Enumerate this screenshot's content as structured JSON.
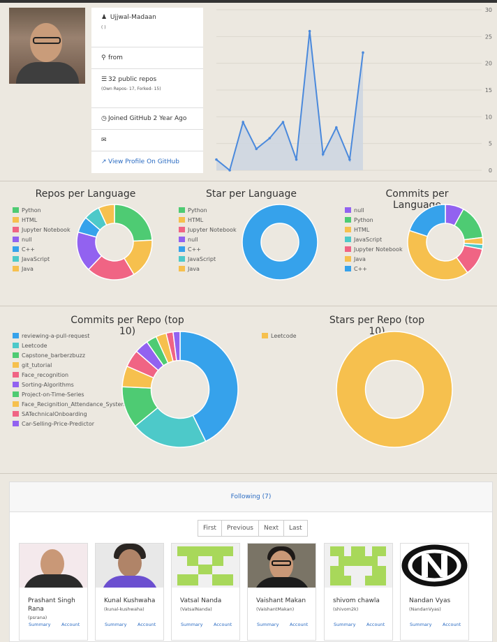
{
  "profile": {
    "username": "Ujjwal-Madaan",
    "name_paren": "( )",
    "location": "from",
    "repos": "32 public repos",
    "repos_detail": "(Own Repos- 17, Forked- 15)",
    "joined": "Joined GitHub 2 Year Ago",
    "email": "",
    "view_profile": "View Profile On GitHub"
  },
  "line_chart": {
    "chart_data": {
      "type": "area",
      "values": [
        2,
        0,
        9,
        4,
        6,
        9,
        2,
        26,
        3,
        8,
        2,
        22
      ],
      "ylim": [
        0,
        30
      ],
      "yticks": [
        "0",
        "5",
        "10",
        "15",
        "20",
        "25",
        "30"
      ],
      "colors": {
        "line": "#4a89dc",
        "fill": "#ccd5e0"
      }
    }
  },
  "repos_per_language": {
    "title": "Repos per Language",
    "chart_data": {
      "type": "pie",
      "labels": [
        "Python",
        "HTML",
        "Jupyter Notebook",
        "null",
        "C++",
        "JavaScript",
        "Java"
      ],
      "values": [
        7,
        5,
        6,
        5,
        2,
        2,
        2
      ],
      "colors": [
        "#4ecb73",
        "#f6c04e",
        "#f06484",
        "#9262f0",
        "#36a2eb",
        "#4dc9c9",
        "#f6c04e"
      ]
    }
  },
  "star_per_language": {
    "title": "Star per Language",
    "chart_data": {
      "type": "pie",
      "labels": [
        "Python",
        "HTML",
        "Jupyter Notebook",
        "null",
        "C++",
        "JavaScript",
        "Java"
      ],
      "values": [
        0,
        0,
        0,
        0,
        1,
        0,
        0
      ],
      "colors": [
        "#4ecb73",
        "#f6c04e",
        "#f06484",
        "#9262f0",
        "#36a2eb",
        "#4dc9c9",
        "#f6c04e"
      ]
    }
  },
  "commits_per_language": {
    "title": "Commits per Language",
    "chart_data": {
      "type": "pie",
      "labels": [
        "null",
        "Python",
        "HTML",
        "JavaScript",
        "Jupyter Notebook",
        "Java",
        "C++"
      ],
      "values": [
        8,
        15,
        3,
        2,
        12,
        40,
        20
      ],
      "colors": [
        "#9262f0",
        "#4ecb73",
        "#f6c04e",
        "#4dc9c9",
        "#f06484",
        "#f6c04e",
        "#36a2eb"
      ]
    }
  },
  "commits_per_repo": {
    "title": "Commits per Repo (top 10)",
    "chart_data": {
      "type": "pie",
      "labels": [
        "reviewing-a-pull-request",
        "Leetcode",
        "Capstone_barberzbuzz",
        "git_tutorial",
        "Face_recognition",
        "Sorting-Algorithms",
        "Project-on-Time-Series",
        "Face_Recignition_Attendance_System",
        "SATechnicalOnboarding",
        "Car-Selling-Price-Predictor"
      ],
      "values": [
        44,
        22,
        12,
        6,
        5,
        4,
        3,
        3,
        2,
        2
      ],
      "colors": [
        "#36a2eb",
        "#4dc9c9",
        "#4ecb73",
        "#f6c04e",
        "#f06484",
        "#9262f0",
        "#4ecb73",
        "#f6c04e",
        "#f06484",
        "#9262f0"
      ]
    }
  },
  "stars_per_repo": {
    "title": "Stars per Repo (top 10)",
    "chart_data": {
      "type": "pie",
      "labels": [
        "Leetcode"
      ],
      "values": [
        1
      ],
      "colors": [
        "#f6c04e"
      ]
    }
  },
  "following": {
    "header": "Following (7)",
    "pager": [
      "First",
      "Previous",
      "Next",
      "Last"
    ],
    "summary_label": "Summary",
    "account_label": "Account",
    "users": [
      {
        "name": "Prashant Singh Rana",
        "login": "(psrana)"
      },
      {
        "name": "Kunal Kushwaha",
        "login": "(kunal-kushwaha)"
      },
      {
        "name": "Vatsal Nanda",
        "login": "(VatsalNanda)"
      },
      {
        "name": "Vaishant Makan",
        "login": "(VaishantMakan)"
      },
      {
        "name": "shivom chawla",
        "login": "(shivom2k)"
      },
      {
        "name": "Nandan Vyas",
        "login": "(NandanVyas)"
      }
    ]
  }
}
